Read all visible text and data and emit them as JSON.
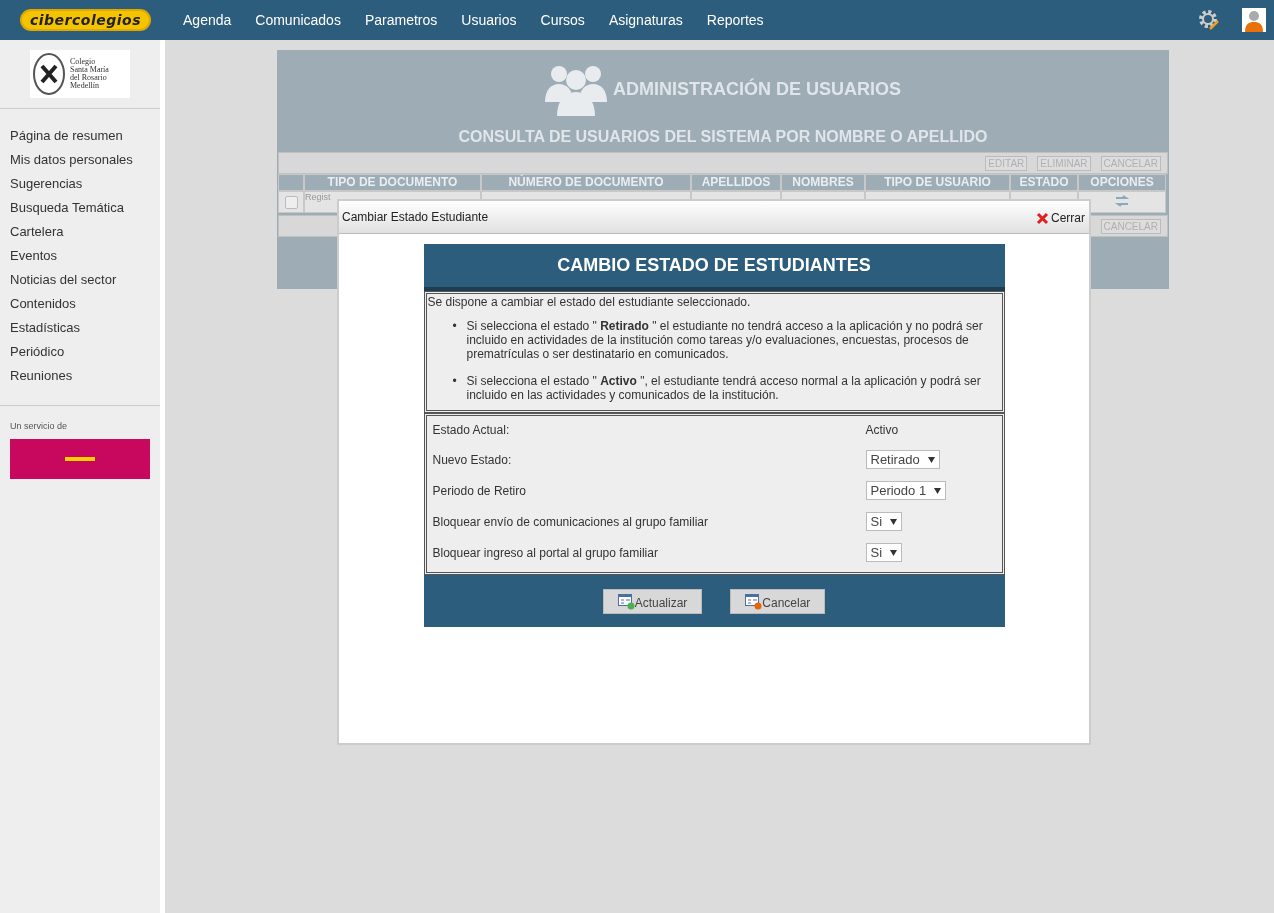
{
  "topbar": {
    "logo": "cibercolegios",
    "menu": [
      {
        "label": "Agenda"
      },
      {
        "label": "Comunicados"
      },
      {
        "label": "Parametros"
      },
      {
        "label": "Usuarios"
      },
      {
        "label": "Cursos"
      },
      {
        "label": "Asignaturas"
      },
      {
        "label": "Reportes"
      }
    ]
  },
  "sidebar": {
    "school": [
      "Colegio",
      "Santa María",
      "del Rosario",
      "Medellín"
    ],
    "items": [
      {
        "label": "Página de resumen"
      },
      {
        "label": "Mis datos personales"
      },
      {
        "label": "Sugerencias"
      },
      {
        "label": "Busqueda Temática"
      },
      {
        "label": "Cartelera"
      },
      {
        "label": "Eventos"
      },
      {
        "label": "Noticias del sector"
      },
      {
        "label": "Contenidos"
      },
      {
        "label": "Estadísticas"
      },
      {
        "label": "Periódico"
      },
      {
        "label": "Reuniones"
      }
    ],
    "service_label": "Un servicio de"
  },
  "panel": {
    "title": "ADMINISTRACIÓN DE USUARIOS",
    "subtitle": "CONSULTA DE USUARIOS DEL SISTEMA POR NOMBRE O APELLIDO",
    "actions": [
      {
        "label": "EDITAR",
        "disabled": true
      },
      {
        "label": "ELIMINAR",
        "disabled": true
      },
      {
        "label": "CANCELAR",
        "disabled": true
      }
    ],
    "columns": [
      "TIPO DE DOCUMENTO",
      "NÚMERO DE DOCUMENTO",
      "APELLIDOS",
      "NOMBRES",
      "TIPO DE USUARIO",
      "ESTADO",
      "OPCIONES"
    ],
    "rows": [
      {
        "checked": false,
        "cells": [
          "Regist"
        ]
      }
    ],
    "bottom_actions": [
      {
        "label": "CANCELAR",
        "disabled": true
      }
    ]
  },
  "dialog": {
    "title": "Cambiar Estado Estudiante",
    "close": "Cerrar",
    "heading": "CAMBIO ESTADO DE ESTUDIANTES",
    "intro": "Se dispone a cambiar el estado del estudiante seleccionado.",
    "bullets": [
      {
        "marker": "•",
        "text": "Si selecciona el estado \" **Retirado** \" el estudiante no tendrá acceso a la aplicación y no podrá ser incluido en actividades de la institución como tareas y/o evaluaciones, encuestas, procesos de prematrículas o ser destinatario en comunicados."
      },
      {
        "marker": "•",
        "text": "Si selecciona el estado \" **Activo** \", el estudiante tendrá acceso normal a la aplicación y podrá ser incluido en las actividades y comunicados de la institución."
      }
    ],
    "fields": [
      {
        "kind": "text",
        "label": "Estado Actual:",
        "value": "Activo"
      },
      {
        "kind": "select",
        "label": "Nuevo Estado:",
        "value": "Retirado"
      },
      {
        "kind": "select",
        "label": "Periodo de Retiro",
        "value": "Periodo 1"
      },
      {
        "kind": "select",
        "label": "Bloquear envío de comunicaciones al grupo familiar",
        "value": "Si"
      },
      {
        "kind": "select",
        "label": "Bloquear ingreso al portal al grupo familiar",
        "value": "Si"
      }
    ],
    "buttons": [
      {
        "kind": "add",
        "label": "Actualizar"
      },
      {
        "kind": "remove",
        "label": "Cancelar"
      }
    ]
  }
}
